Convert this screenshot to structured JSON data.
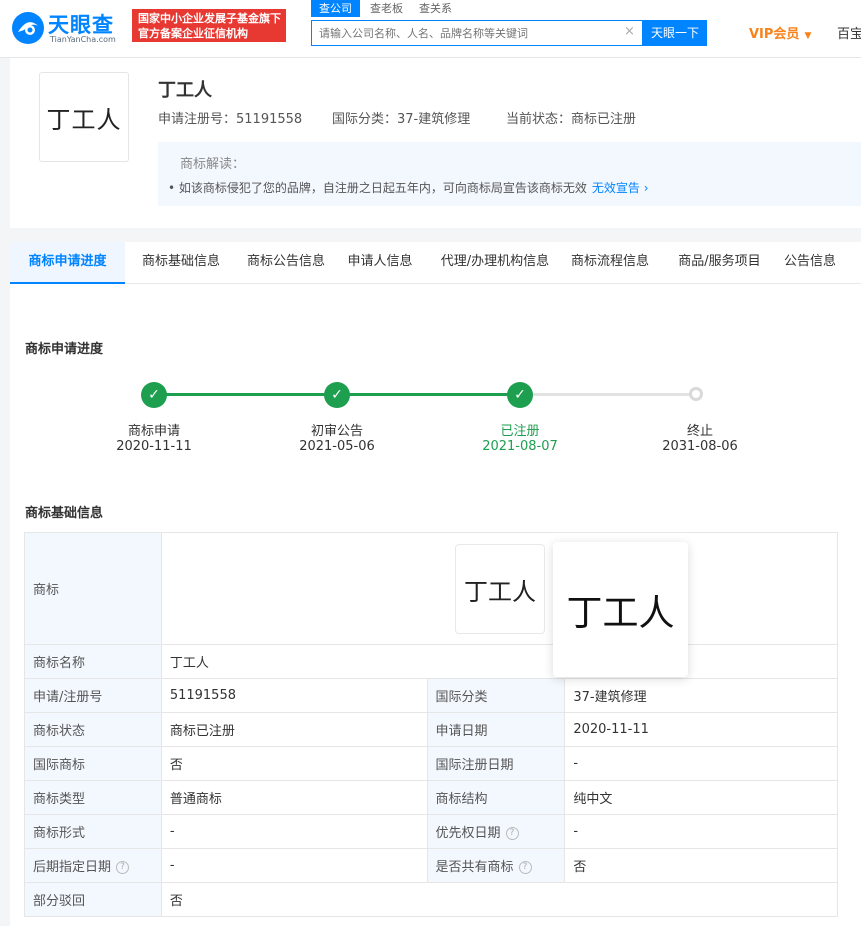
{
  "header": {
    "logo_text": "天眼查",
    "logo_sub": "TianYanCha.com",
    "badge_line1": "国家中小企业发展子基金旗下",
    "badge_line2": "官方备案企业征信机构",
    "search_tabs": [
      "查公司",
      "查老板",
      "查关系"
    ],
    "search_placeholder": "请输入公司名称、人名、品牌名称等关键词",
    "search_button": "天眼一下",
    "vip_label": "VIP会员",
    "baike_label": "百宝"
  },
  "trademark": {
    "name": "丁工人",
    "reg_no_label": "申请注册号：",
    "reg_no": "51191558",
    "intl_class_label": "国际分类：",
    "intl_class": "37-建筑修理",
    "status_label": "当前状态：",
    "status": "商标已注册",
    "interp_title": "商标解读：",
    "interp_text": "如该商标侵犯了您的品牌，自注册之日起五年内，可向商标局宣告该商标无效",
    "interp_link": "无效宣告"
  },
  "tabs": [
    "商标申请进度",
    "商标基础信息",
    "商标公告信息",
    "申请人信息",
    "代理/办理机构信息",
    "商标流程信息",
    "商品/服务项目",
    "公告信息"
  ],
  "progress": {
    "title": "商标申请进度",
    "steps": [
      {
        "label": "商标申请",
        "date": "2020-11-11",
        "done": true
      },
      {
        "label": "初审公告",
        "date": "2021-05-06",
        "done": true
      },
      {
        "label": "已注册",
        "date": "2021-08-07",
        "done": true
      },
      {
        "label": "终止",
        "date": "2031-08-06",
        "done": false
      }
    ]
  },
  "basic_info": {
    "title": "商标基础信息",
    "labels": {
      "trademark": "商标",
      "name": "商标名称",
      "reg_no": "申请/注册号",
      "intl_class": "国际分类",
      "status": "商标状态",
      "apply_date": "申请日期",
      "intl_mark": "国际商标",
      "intl_reg_date": "国际注册日期",
      "type": "商标类型",
      "structure": "商标结构",
      "form": "商标形式",
      "priority_date": "优先权日期",
      "later_date": "后期指定日期",
      "shared": "是否共有商标",
      "partial_reject": "部分驳回"
    },
    "values": {
      "name": "丁工人",
      "reg_no": "51191558",
      "intl_class": "37-建筑修理",
      "status": "商标已注册",
      "apply_date": "2020-11-11",
      "intl_mark": "否",
      "intl_reg_date": "-",
      "type": "普通商标",
      "structure": "纯中文",
      "form": "-",
      "priority_date": "-",
      "later_date": "-",
      "shared": "否",
      "partial_reject": "否"
    }
  },
  "colors": {
    "brand": "#0084ff",
    "success": "#1e9e4f",
    "badge": "#e73832",
    "vip": "#f7821b"
  }
}
